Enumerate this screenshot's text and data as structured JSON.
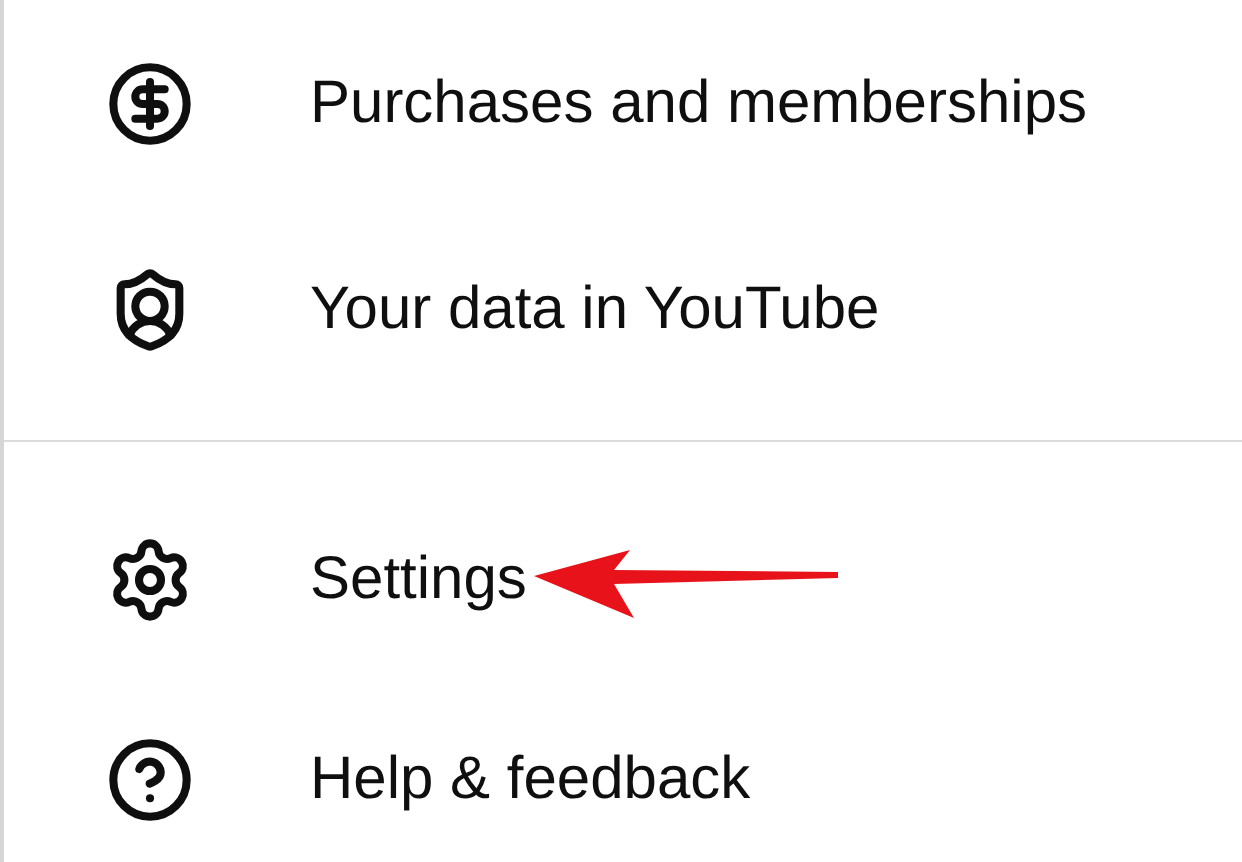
{
  "menu": {
    "groups": [
      {
        "items": [
          {
            "label": "Purchases and memberships"
          },
          {
            "label": "Your data in YouTube"
          }
        ]
      },
      {
        "items": [
          {
            "label": "Settings",
            "highlighted": true
          },
          {
            "label": "Help & feedback",
            "highlighted": false
          }
        ]
      }
    ]
  }
}
